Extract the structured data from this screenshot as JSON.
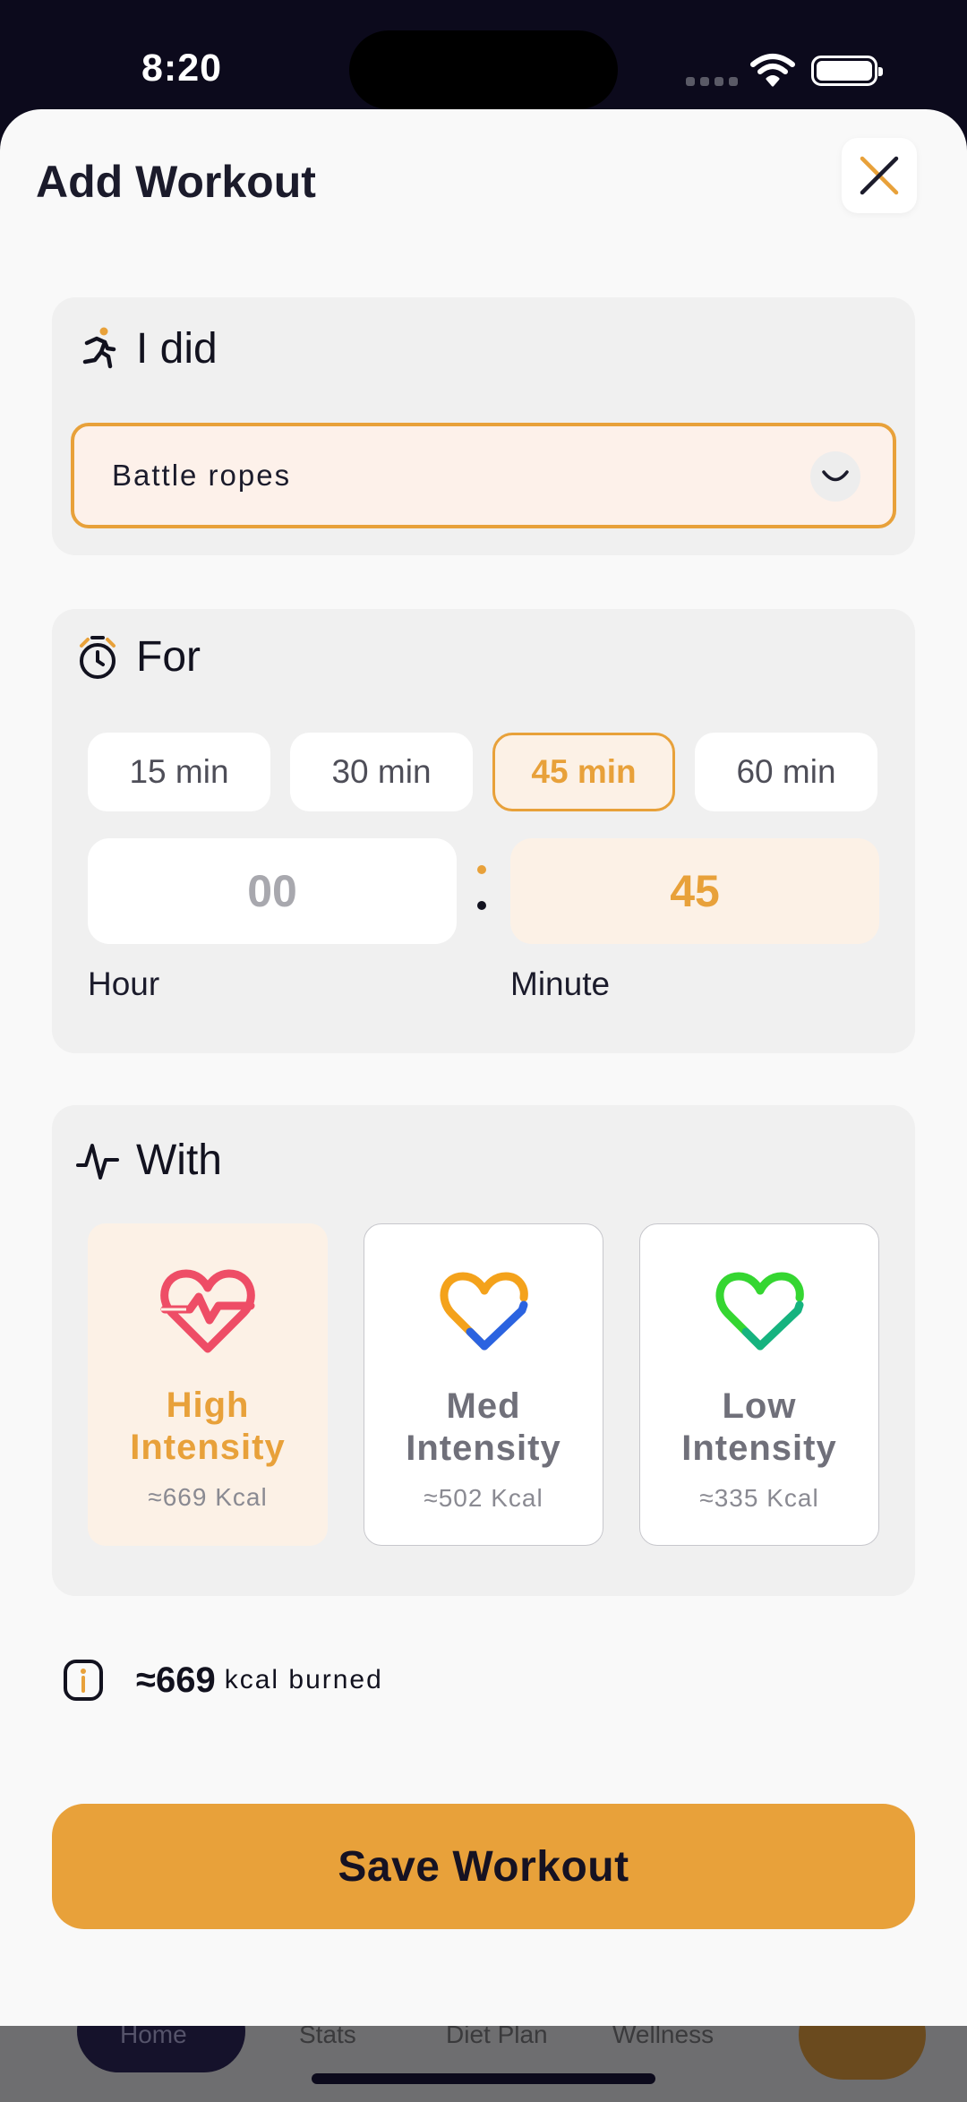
{
  "status_bar": {
    "time": "8:20"
  },
  "header": {
    "title": "Add Workout",
    "close_icon": "close-icon"
  },
  "did": {
    "label": "I did",
    "icon": "running-person-icon",
    "selected_activity": "Battle ropes",
    "dropdown_icon": "chevron-down-icon"
  },
  "duration": {
    "label": "For",
    "icon": "stopwatch-icon",
    "presets": [
      "15 min",
      "30 min",
      "45 min",
      "60 min"
    ],
    "selected_preset": "45 min",
    "hour_value": "00",
    "minute_value": "45",
    "hour_label": "Hour",
    "minute_label": "Minute"
  },
  "intensity": {
    "label": "With",
    "icon": "pulse-icon",
    "options": [
      {
        "name_line1": "High",
        "name_line2": "Intensity",
        "kcal": "≈669 Kcal",
        "selected": true
      },
      {
        "name_line1": "Med",
        "name_line2": "Intensity",
        "kcal": "≈502 Kcal",
        "selected": false
      },
      {
        "name_line1": "Low",
        "name_line2": "Intensity",
        "kcal": "≈335 Kcal",
        "selected": false
      }
    ]
  },
  "summary": {
    "value": "≈669",
    "unit": "kcal burned",
    "icon": "info-icon"
  },
  "actions": {
    "save_label": "Save Workout"
  },
  "colors": {
    "accent": "#e8a13a",
    "high": "#ee4d66",
    "med_orange": "#f4a21b",
    "med_blue": "#2b63e0",
    "low_green": "#35d631",
    "low_teal": "#16b37f"
  },
  "background_tabs": [
    "Home",
    "Stats",
    "Diet Plan",
    "Wellness"
  ]
}
